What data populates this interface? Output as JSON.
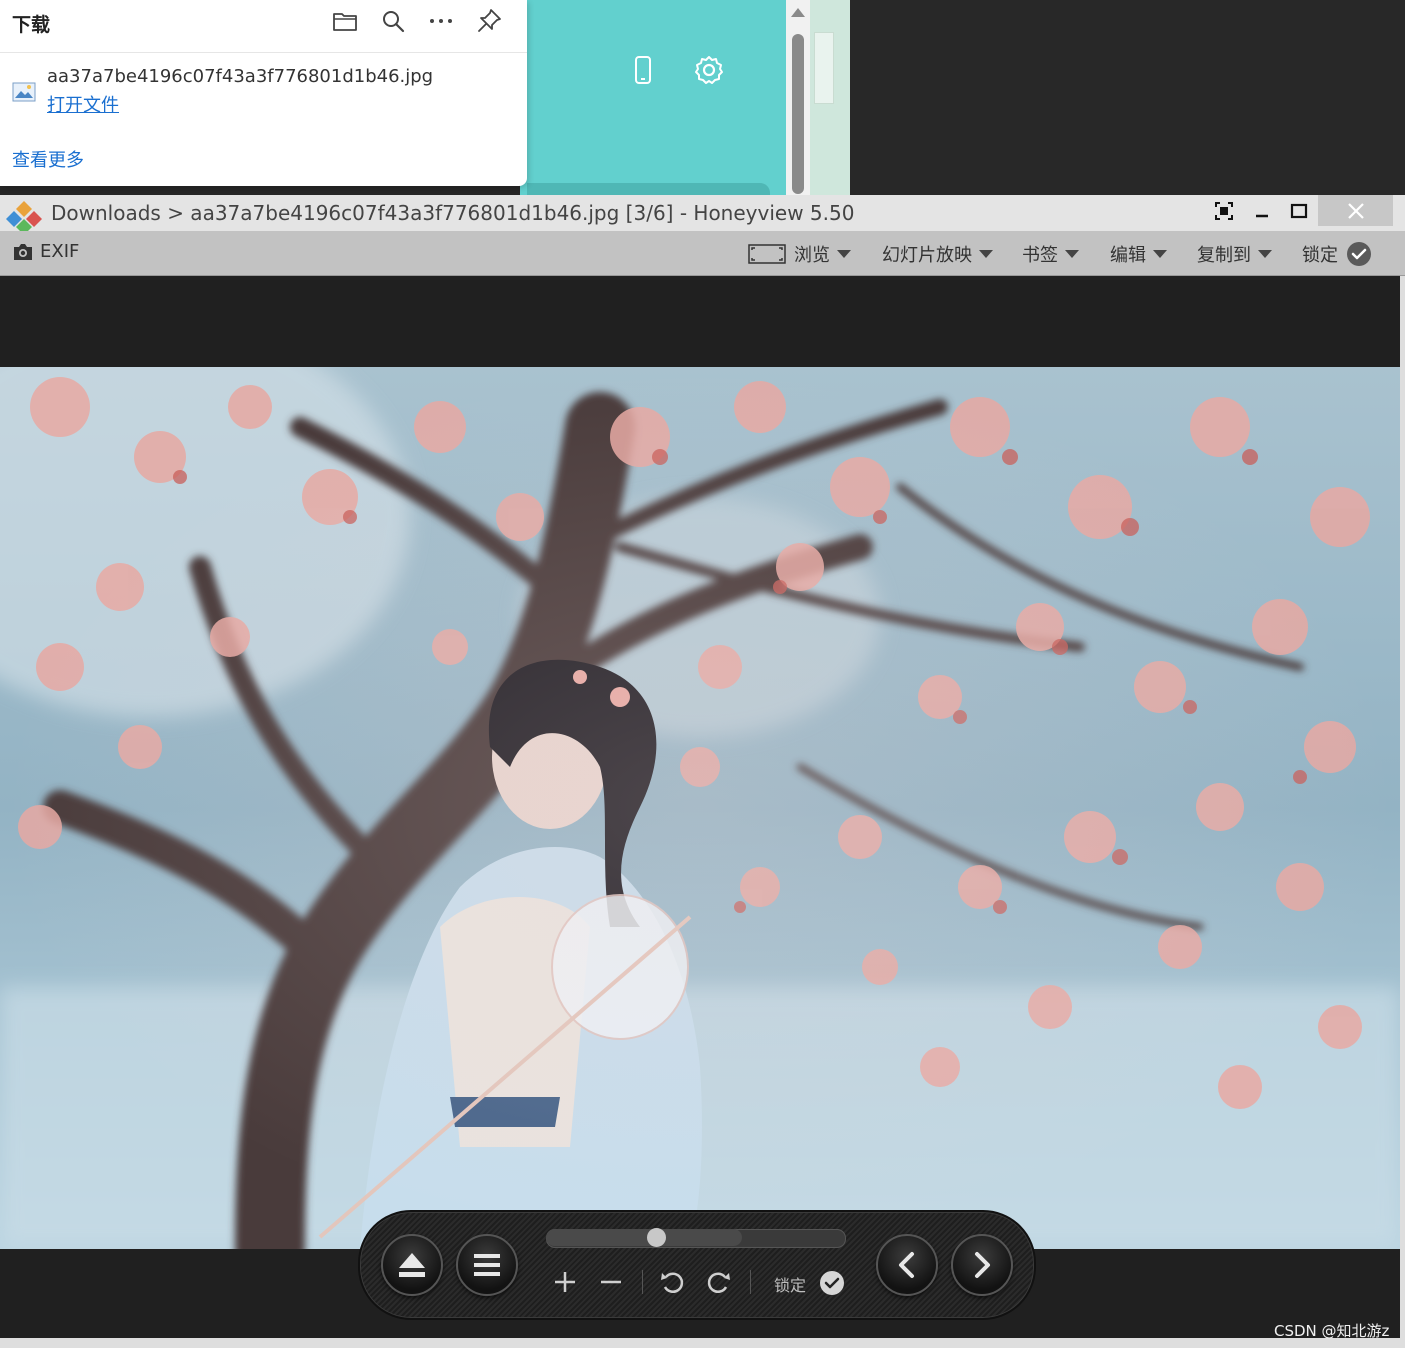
{
  "download_panel": {
    "title": "下载",
    "toolbar_icons": [
      "folder-icon",
      "search-icon",
      "more-icon",
      "pin-icon"
    ],
    "file": {
      "name": "aa37a7be4196c07f43a3f776801d1b46.jpg",
      "open_label": "打开文件"
    },
    "see_more_label": "查看更多"
  },
  "background_app": {
    "icons": [
      "phone-icon",
      "settings-icon"
    ],
    "accent_color": "#62d0ce"
  },
  "viewer": {
    "window_title": "Downloads > aa37a7be4196c07f43a3f776801d1b46.jpg [3/6] - Honeyview 5.50",
    "toolbar": {
      "exif_label": "EXIF",
      "browse_label": "浏览",
      "slideshow_label": "幻灯片放映",
      "bookmark_label": "书签",
      "edit_label": "编辑",
      "copy_to_label": "复制到",
      "lock_label": "锁定"
    },
    "image_index": "3/6",
    "control_bar": {
      "lock_label": "锁定",
      "slider_position": 0.37
    }
  },
  "watermark": "CSDN @知北游z"
}
